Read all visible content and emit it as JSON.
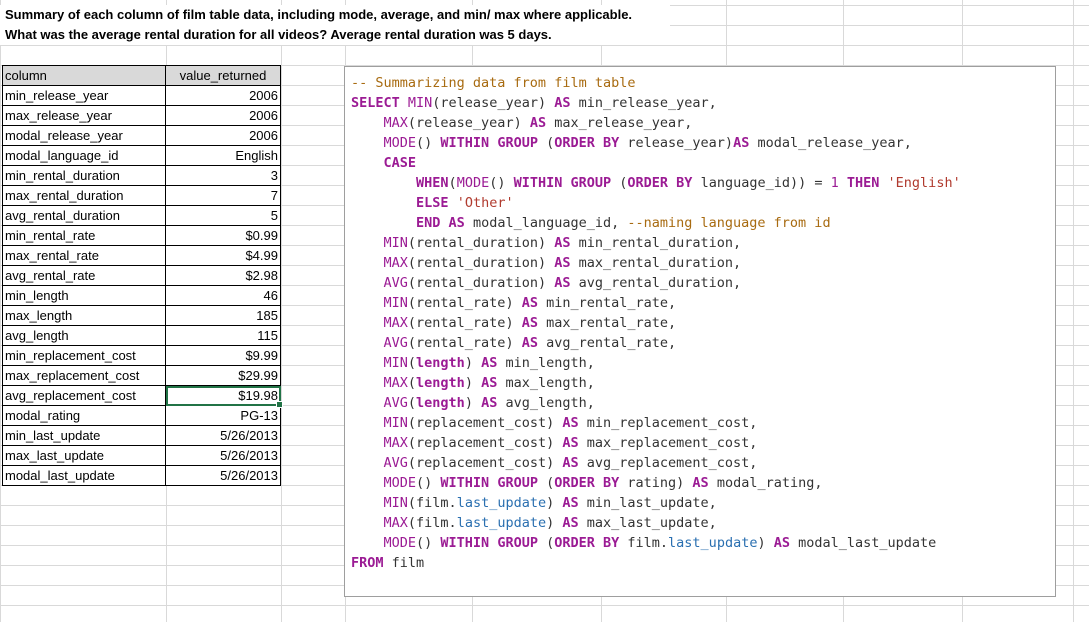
{
  "sheet": {
    "header_line1": "Summary of each column of film table data, including mode, average, and min/ max where applicable.",
    "header_line2": "What was the average rental duration for all videos? Average rental duration was 5 days."
  },
  "table": {
    "columns": [
      "column",
      "value_returned"
    ],
    "rows": [
      [
        "min_release_year",
        "2006"
      ],
      [
        "max_release_year",
        "2006"
      ],
      [
        "modal_release_year",
        "2006"
      ],
      [
        "modal_language_id",
        "English"
      ],
      [
        "min_rental_duration",
        "3"
      ],
      [
        "max_rental_duration",
        "7"
      ],
      [
        "avg_rental_duration",
        "5"
      ],
      [
        "min_rental_rate",
        "$0.99"
      ],
      [
        "max_rental_rate",
        "$4.99"
      ],
      [
        "avg_rental_rate",
        "$2.98"
      ],
      [
        "min_length",
        "46"
      ],
      [
        "max_length",
        "185"
      ],
      [
        "avg_length",
        "115"
      ],
      [
        "min_replacement_cost",
        "$9.99"
      ],
      [
        "max_replacement_cost",
        "$29.99"
      ],
      [
        "avg_replacement_cost",
        "$19.98"
      ],
      [
        "modal_rating",
        "PG-13"
      ],
      [
        "min_last_update",
        "5/26/2013"
      ],
      [
        "max_last_update",
        "5/26/2013"
      ],
      [
        "modal_last_update",
        "5/26/2013"
      ]
    ],
    "selected_row": 15,
    "selection_color": "#217346"
  },
  "code": {
    "lines": [
      [
        [
          "cm",
          "-- Summarizing data from film table"
        ]
      ],
      [
        [
          "kw",
          "SELECT "
        ],
        [
          "fn",
          "MIN"
        ],
        [
          "id",
          "(release_year) "
        ],
        [
          "kw",
          "AS"
        ],
        [
          "id",
          " min_release_year,"
        ]
      ],
      [
        [
          "id",
          "    "
        ],
        [
          "fn",
          "MAX"
        ],
        [
          "id",
          "(release_year) "
        ],
        [
          "kw",
          "AS"
        ],
        [
          "id",
          " max_release_year,"
        ]
      ],
      [
        [
          "id",
          "    "
        ],
        [
          "fn",
          "MODE"
        ],
        [
          "id",
          "() "
        ],
        [
          "kw",
          "WITHIN GROUP"
        ],
        [
          "id",
          " ("
        ],
        [
          "kw",
          "ORDER BY"
        ],
        [
          "id",
          " release_year)"
        ],
        [
          "kw",
          "AS"
        ],
        [
          "id",
          " modal_release_year,"
        ]
      ],
      [
        [
          "id",
          "    "
        ],
        [
          "kw",
          "CASE"
        ]
      ],
      [
        [
          "id",
          "        "
        ],
        [
          "kw",
          "WHEN"
        ],
        [
          "id",
          "("
        ],
        [
          "fn",
          "MODE"
        ],
        [
          "id",
          "() "
        ],
        [
          "kw",
          "WITHIN GROUP"
        ],
        [
          "id",
          " ("
        ],
        [
          "kw",
          "ORDER BY"
        ],
        [
          "id",
          " language_id)) = "
        ],
        [
          "num",
          "1"
        ],
        [
          "id",
          " "
        ],
        [
          "kw",
          "THEN"
        ],
        [
          "id",
          " "
        ],
        [
          "str",
          "'English'"
        ]
      ],
      [
        [
          "id",
          "        "
        ],
        [
          "kw",
          "ELSE"
        ],
        [
          "id",
          " "
        ],
        [
          "str",
          "'Other'"
        ]
      ],
      [
        [
          "id",
          "        "
        ],
        [
          "kw",
          "END AS"
        ],
        [
          "id",
          " modal_language_id, "
        ],
        [
          "cm",
          "--naming language from id"
        ]
      ],
      [
        [
          "id",
          "    "
        ],
        [
          "fn",
          "MIN"
        ],
        [
          "id",
          "(rental_duration) "
        ],
        [
          "kw",
          "AS"
        ],
        [
          "id",
          " min_rental_duration,"
        ]
      ],
      [
        [
          "id",
          "    "
        ],
        [
          "fn",
          "MAX"
        ],
        [
          "id",
          "(rental_duration) "
        ],
        [
          "kw",
          "AS"
        ],
        [
          "id",
          " max_rental_duration,"
        ]
      ],
      [
        [
          "id",
          "    "
        ],
        [
          "fn",
          "AVG"
        ],
        [
          "id",
          "(rental_duration) "
        ],
        [
          "kw",
          "AS"
        ],
        [
          "id",
          " avg_rental_duration,"
        ]
      ],
      [
        [
          "id",
          "    "
        ],
        [
          "fn",
          "MIN"
        ],
        [
          "id",
          "(rental_rate) "
        ],
        [
          "kw",
          "AS"
        ],
        [
          "id",
          " min_rental_rate,"
        ]
      ],
      [
        [
          "id",
          "    "
        ],
        [
          "fn",
          "MAX"
        ],
        [
          "id",
          "(rental_rate) "
        ],
        [
          "kw",
          "AS"
        ],
        [
          "id",
          " max_rental_rate,"
        ]
      ],
      [
        [
          "id",
          "    "
        ],
        [
          "fn",
          "AVG"
        ],
        [
          "id",
          "(rental_rate) "
        ],
        [
          "kw",
          "AS"
        ],
        [
          "id",
          " avg_rental_rate,"
        ]
      ],
      [
        [
          "id",
          "    "
        ],
        [
          "fn",
          "MIN"
        ],
        [
          "id",
          "("
        ],
        [
          "kw",
          "length"
        ],
        [
          "id",
          ") "
        ],
        [
          "kw",
          "AS"
        ],
        [
          "id",
          " min_length,"
        ]
      ],
      [
        [
          "id",
          "    "
        ],
        [
          "fn",
          "MAX"
        ],
        [
          "id",
          "("
        ],
        [
          "kw",
          "length"
        ],
        [
          "id",
          ") "
        ],
        [
          "kw",
          "AS"
        ],
        [
          "id",
          " max_length,"
        ]
      ],
      [
        [
          "id",
          "    "
        ],
        [
          "fn",
          "AVG"
        ],
        [
          "id",
          "("
        ],
        [
          "kw",
          "length"
        ],
        [
          "id",
          ") "
        ],
        [
          "kw",
          "AS"
        ],
        [
          "id",
          " avg_length,"
        ]
      ],
      [
        [
          "id",
          "    "
        ],
        [
          "fn",
          "MIN"
        ],
        [
          "id",
          "(replacement_cost) "
        ],
        [
          "kw",
          "AS"
        ],
        [
          "id",
          " min_replacement_cost,"
        ]
      ],
      [
        [
          "id",
          "    "
        ],
        [
          "fn",
          "MAX"
        ],
        [
          "id",
          "(replacement_cost) "
        ],
        [
          "kw",
          "AS"
        ],
        [
          "id",
          " max_replacement_cost,"
        ]
      ],
      [
        [
          "id",
          "    "
        ],
        [
          "fn",
          "AVG"
        ],
        [
          "id",
          "(replacement_cost) "
        ],
        [
          "kw",
          "AS"
        ],
        [
          "id",
          " avg_replacement_cost,"
        ]
      ],
      [
        [
          "id",
          "    "
        ],
        [
          "fn",
          "MODE"
        ],
        [
          "id",
          "() "
        ],
        [
          "kw",
          "WITHIN GROUP"
        ],
        [
          "id",
          " ("
        ],
        [
          "kw",
          "ORDER BY"
        ],
        [
          "id",
          " rating) "
        ],
        [
          "kw",
          "AS"
        ],
        [
          "id",
          " modal_rating,"
        ]
      ],
      [
        [
          "id",
          "    "
        ],
        [
          "fn",
          "MIN"
        ],
        [
          "id",
          "(film."
        ],
        [
          "obj",
          "last_update"
        ],
        [
          "id",
          ") "
        ],
        [
          "kw",
          "AS"
        ],
        [
          "id",
          " min_last_update,"
        ]
      ],
      [
        [
          "id",
          "    "
        ],
        [
          "fn",
          "MAX"
        ],
        [
          "id",
          "(film."
        ],
        [
          "obj",
          "last_update"
        ],
        [
          "id",
          ") "
        ],
        [
          "kw",
          "AS"
        ],
        [
          "id",
          " max_last_update,"
        ]
      ],
      [
        [
          "id",
          "    "
        ],
        [
          "fn",
          "MODE"
        ],
        [
          "id",
          "() "
        ],
        [
          "kw",
          "WITHIN GROUP"
        ],
        [
          "id",
          " ("
        ],
        [
          "kw",
          "ORDER BY"
        ],
        [
          "id",
          " film."
        ],
        [
          "obj",
          "last_update"
        ],
        [
          "id",
          ") "
        ],
        [
          "kw",
          "AS"
        ],
        [
          "id",
          " modal_last_update"
        ]
      ],
      [
        [
          "kw",
          "FROM"
        ],
        [
          "id",
          " film"
        ]
      ]
    ]
  }
}
